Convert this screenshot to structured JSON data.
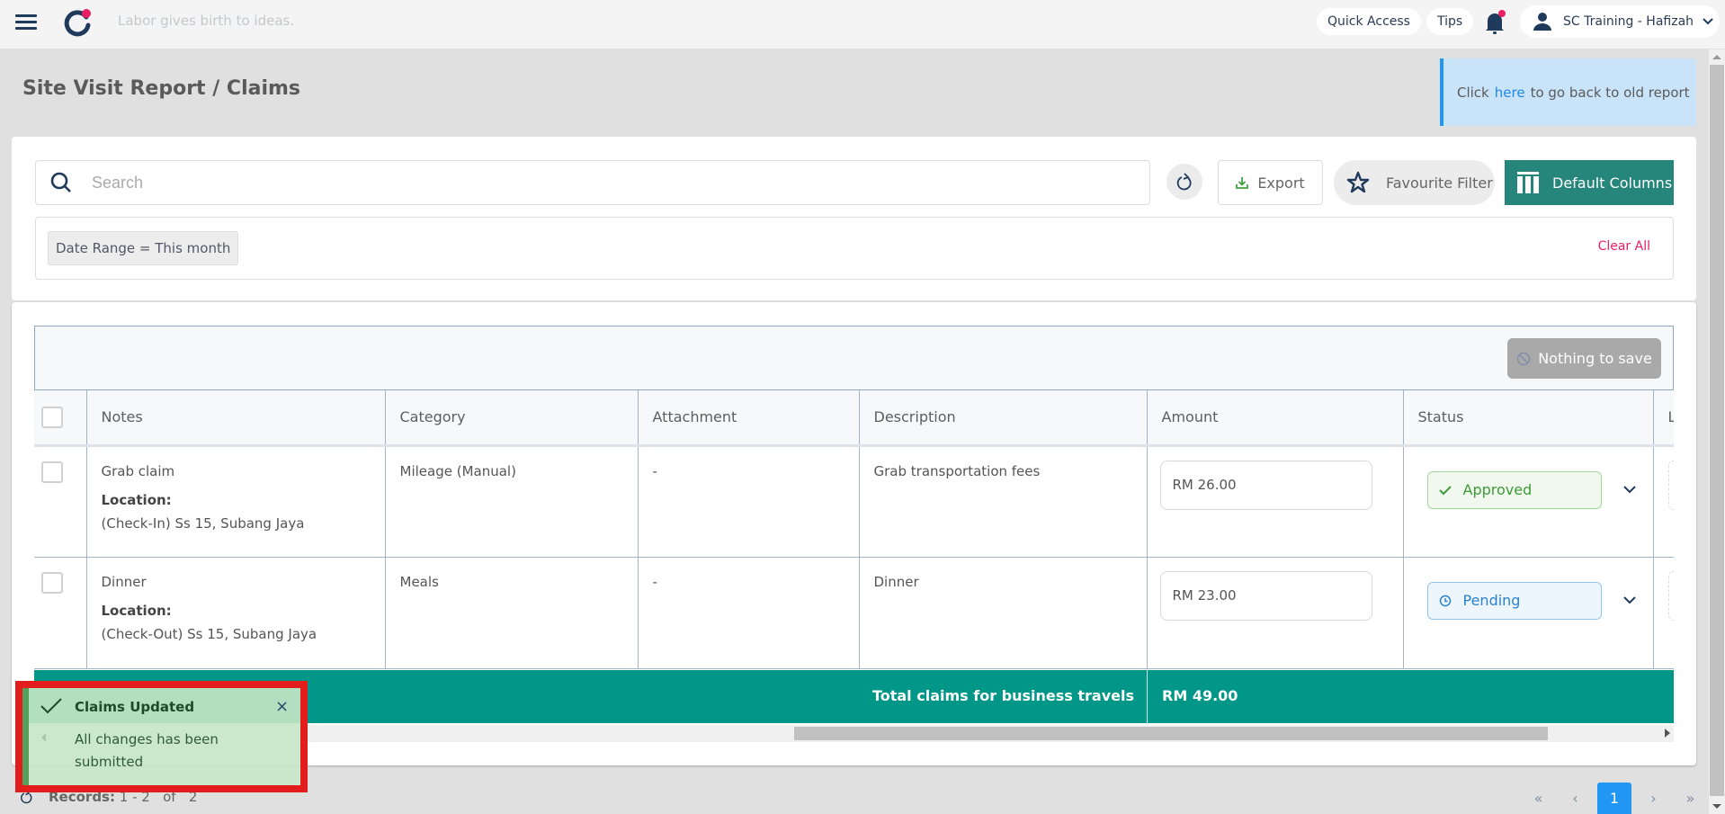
{
  "topbar": {
    "tagline": "Labor gives birth to ideas.",
    "quick_access": "Quick Access",
    "tips": "Tips",
    "user_name": "SC Training - Hafizah",
    "accent": "#e91e63"
  },
  "page": {
    "title": "Site Visit Report / Claims",
    "old_report": {
      "prefix": "Click",
      "link": "here",
      "suffix": "to go back to old report"
    }
  },
  "toolbar": {
    "search_placeholder": "Search",
    "export_label": "Export",
    "favourite_filter_label": "Favourite Filter",
    "default_columns_label": "Default Columns"
  },
  "filters": {
    "chips": [
      {
        "label": "Date Range = This month"
      }
    ],
    "clear_all": "Clear All"
  },
  "save_bar": {
    "nothing_to_save": "Nothing to save"
  },
  "table": {
    "columns": [
      "Notes",
      "Category",
      "Attachment",
      "Description",
      "Amount",
      "Status",
      "L"
    ],
    "rows": [
      {
        "notes": "Grab claim",
        "location_label": "Location:",
        "location": "(Check-In) Ss 15, Subang Jaya",
        "category": "Mileage (Manual)",
        "attachment": "-",
        "description": "Grab transportation fees",
        "amount": "RM 26.00",
        "status": "Approved"
      },
      {
        "notes": "Dinner",
        "location_label": "Location:",
        "location": "(Check-Out) Ss 15, Subang Jaya",
        "category": "Meals",
        "attachment": "-",
        "description": "Dinner",
        "amount": "RM 23.00",
        "status": "Pending"
      }
    ],
    "total_label": "Total claims for business travels",
    "total_value": "RM 49.00"
  },
  "footer": {
    "records_label": "Records:",
    "records_range": "1 - 2",
    "records_of": "of",
    "records_total": "2",
    "pagination": {
      "first": "«",
      "prev": "‹",
      "current": "1",
      "next": "›",
      "last": "»"
    }
  },
  "toast": {
    "title": "Claims Updated",
    "message": "All changes has been submitted",
    "close": "×"
  }
}
